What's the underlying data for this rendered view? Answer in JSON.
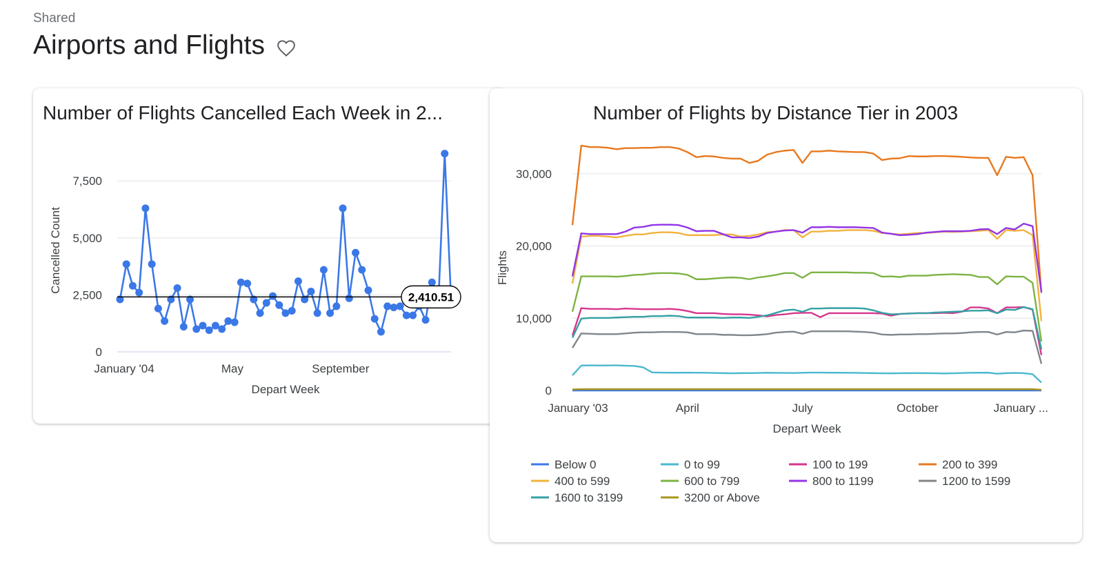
{
  "header": {
    "breadcrumb": "Shared",
    "title": "Airports and Flights",
    "favorite_icon": "heart-outline-icon"
  },
  "colors": {
    "accent": "#3b78e7",
    "gridline": "#e3e3e3"
  },
  "chart_data": [
    {
      "type": "line",
      "title": "Number of Flights Cancelled Each Week in 2...",
      "xlabel": "Depart Week",
      "ylabel": "Cancelled Count",
      "ylim": [
        0,
        8900
      ],
      "yticks": [
        0,
        2500,
        5000,
        7500
      ],
      "ytick_labels": [
        "0",
        "2,500",
        "5,000",
        "7,500"
      ],
      "xtick_labels": [
        {
          "index": 0,
          "label": "January '04"
        },
        {
          "index": 17,
          "label": "May"
        },
        {
          "index": 34,
          "label": "September"
        }
      ],
      "reference_line": {
        "value": 2410.51,
        "label": "2,410.51"
      },
      "grid": true,
      "markers": true,
      "color": "#3b78e7",
      "values": [
        2300,
        3850,
        2900,
        2600,
        6300,
        3850,
        1900,
        1350,
        2300,
        2800,
        1100,
        2300,
        1000,
        1150,
        950,
        1150,
        1000,
        1350,
        1300,
        3050,
        3000,
        2300,
        1700,
        2150,
        2450,
        2050,
        1700,
        1800,
        3100,
        2300,
        2650,
        1700,
        3600,
        1700,
        2000,
        6300,
        2350,
        4350,
        3600,
        2700,
        1450,
        880,
        2000,
        1950,
        2000,
        1600,
        1600,
        2000,
        1400,
        3050,
        2100,
        8700,
        2300
      ]
    },
    {
      "type": "line",
      "title": "Number of Flights by Distance Tier in 2003",
      "xlabel": "Depart Week",
      "ylabel": "Flights",
      "ylim": [
        0,
        34000
      ],
      "yticks": [
        0,
        10000,
        20000,
        30000
      ],
      "ytick_labels": [
        "0",
        "10,000",
        "20,000",
        "30,000"
      ],
      "xtick_labels": [
        {
          "index": 0,
          "label": "January '03"
        },
        {
          "index": 13,
          "label": "April"
        },
        {
          "index": 26,
          "label": "July"
        },
        {
          "index": 39,
          "label": "October"
        },
        {
          "index": 52,
          "label": "January ..."
        }
      ],
      "grid": true,
      "legend": "bottom",
      "series": [
        {
          "name": "Below 0",
          "color": "#3b78e7",
          "values": [
            0,
            0,
            0,
            0,
            0,
            0,
            0,
            0,
            0,
            0,
            0,
            0,
            0,
            0,
            0,
            0,
            0,
            0,
            0,
            0,
            0,
            0,
            0,
            0,
            0,
            0,
            0,
            0,
            0,
            0,
            0,
            0,
            0,
            0,
            0,
            0,
            0,
            0,
            0,
            0,
            0,
            0,
            0,
            0,
            0,
            0,
            0,
            0,
            0,
            0,
            0,
            0,
            0,
            0
          ]
        },
        {
          "name": "0 to 99",
          "color": "#4ab8cf",
          "values": [
            2100,
            3450,
            3480,
            3460,
            3470,
            3480,
            3430,
            3400,
            3200,
            2500,
            2480,
            2470,
            2460,
            2480,
            2470,
            2450,
            2430,
            2400,
            2380,
            2400,
            2410,
            2430,
            2450,
            2440,
            2430,
            2420,
            2450,
            2480,
            2480,
            2470,
            2460,
            2450,
            2440,
            2420,
            2400,
            2380,
            2370,
            2390,
            2400,
            2410,
            2400,
            2380,
            2360,
            2380,
            2420,
            2450,
            2470,
            2460,
            2320,
            2400,
            2430,
            2390,
            2250,
            1100
          ]
        },
        {
          "name": "100 to 199",
          "color": "#d6368d",
          "values": [
            7600,
            11400,
            11300,
            11300,
            11300,
            11250,
            11350,
            11300,
            11250,
            11250,
            11250,
            11300,
            11200,
            11000,
            10700,
            10700,
            10700,
            10600,
            10550,
            10550,
            10500,
            10400,
            10250,
            10450,
            10550,
            10700,
            10750,
            10750,
            10150,
            10700,
            10700,
            10700,
            10700,
            10700,
            10700,
            10650,
            10350,
            10600,
            10650,
            10700,
            10700,
            10700,
            10750,
            10700,
            10900,
            11500,
            11500,
            11350,
            10700,
            11500,
            11500,
            11550,
            11200,
            4900
          ]
        },
        {
          "name": "200 to 399",
          "color": "#e8781e",
          "values": [
            22900,
            33900,
            33700,
            33700,
            33600,
            33400,
            33550,
            33550,
            33600,
            33600,
            33700,
            33700,
            33500,
            33000,
            32300,
            32450,
            32400,
            32200,
            32100,
            32100,
            31500,
            31800,
            32650,
            33000,
            33200,
            33300,
            31500,
            33100,
            33100,
            33200,
            33100,
            33050,
            33000,
            33000,
            32800,
            31900,
            32100,
            32150,
            32450,
            32400,
            32400,
            32450,
            32450,
            32400,
            32350,
            32250,
            32200,
            32200,
            29800,
            32350,
            32200,
            32300,
            29800,
            13500
          ]
        },
        {
          "name": "400 to 599",
          "color": "#f1b23d",
          "values": [
            14800,
            21300,
            21400,
            21400,
            21300,
            21200,
            21400,
            21600,
            21600,
            21800,
            21900,
            21900,
            21800,
            21500,
            21500,
            21500,
            21500,
            21600,
            21600,
            21300,
            21400,
            21600,
            21900,
            22000,
            22200,
            22200,
            21200,
            22000,
            22000,
            22100,
            22100,
            22200,
            22200,
            22200,
            22100,
            21800,
            21700,
            21600,
            21700,
            21800,
            21800,
            21900,
            22000,
            21950,
            22000,
            22050,
            22100,
            22200,
            21000,
            22200,
            22100,
            22200,
            21500,
            9600
          ]
        },
        {
          "name": "600 to 799",
          "color": "#7cb342",
          "values": [
            10900,
            15800,
            15800,
            15800,
            15800,
            15750,
            15850,
            16000,
            16050,
            16200,
            16250,
            16250,
            16200,
            16000,
            15400,
            15400,
            15500,
            15600,
            15650,
            15600,
            15400,
            15650,
            15800,
            16000,
            16250,
            16250,
            15600,
            16350,
            16350,
            16350,
            16350,
            16350,
            16300,
            16300,
            16250,
            15750,
            15800,
            15700,
            15900,
            15900,
            15900,
            16000,
            16050,
            16100,
            16050,
            16000,
            15700,
            15700,
            14700,
            15800,
            15750,
            15750,
            14900,
            6800
          ]
        },
        {
          "name": "800 to 1199",
          "color": "#9334e6",
          "values": [
            15800,
            21750,
            21650,
            21650,
            21650,
            21650,
            22000,
            22550,
            22650,
            22900,
            22950,
            22950,
            22900,
            22550,
            22050,
            22100,
            22100,
            21650,
            21200,
            21200,
            21100,
            21300,
            21800,
            22000,
            22150,
            22200,
            21850,
            22600,
            22600,
            22650,
            22600,
            22600,
            22600,
            22550,
            22500,
            21850,
            21700,
            21500,
            21550,
            21650,
            21850,
            21950,
            22050,
            22050,
            22050,
            22100,
            22300,
            22350,
            21650,
            22500,
            22300,
            23100,
            22750,
            13600
          ]
        },
        {
          "name": "1200 to 1599",
          "color": "#80868b",
          "values": [
            5900,
            7900,
            7850,
            7800,
            7800,
            7800,
            7900,
            8000,
            8050,
            8050,
            8100,
            8100,
            8100,
            8050,
            7800,
            7800,
            7800,
            7700,
            7700,
            7650,
            7650,
            7700,
            7800,
            8000,
            8100,
            8150,
            7850,
            8200,
            8200,
            8200,
            8200,
            8200,
            8150,
            8100,
            8000,
            7750,
            7700,
            7750,
            7750,
            7800,
            7800,
            7850,
            7900,
            7900,
            7950,
            8050,
            8100,
            8100,
            7750,
            8100,
            8050,
            8300,
            8250,
            3700
          ]
        },
        {
          "name": "1600 to 3199",
          "color": "#34a0a4",
          "values": [
            7300,
            9950,
            10050,
            10050,
            10050,
            10100,
            10150,
            10200,
            10200,
            10300,
            10300,
            10350,
            10300,
            10100,
            10100,
            10100,
            10100,
            10050,
            10100,
            10100,
            10050,
            10200,
            10400,
            10750,
            11100,
            11200,
            10900,
            11350,
            11350,
            11400,
            11400,
            11400,
            11400,
            11350,
            11100,
            10750,
            10550,
            10600,
            10650,
            10700,
            10700,
            10800,
            10850,
            10900,
            10950,
            11050,
            11050,
            11100,
            10700,
            11200,
            11150,
            11550,
            11250,
            5700
          ]
        },
        {
          "name": "3200 or Above",
          "color": "#a7961c",
          "values": [
            150,
            180,
            180,
            180,
            180,
            180,
            180,
            180,
            180,
            180,
            180,
            180,
            180,
            180,
            180,
            180,
            180,
            180,
            180,
            180,
            180,
            180,
            180,
            180,
            180,
            180,
            180,
            180,
            180,
            180,
            180,
            180,
            180,
            180,
            180,
            180,
            180,
            180,
            180,
            180,
            180,
            180,
            180,
            180,
            180,
            180,
            180,
            180,
            180,
            180,
            180,
            180,
            180,
            100
          ]
        }
      ]
    }
  ]
}
